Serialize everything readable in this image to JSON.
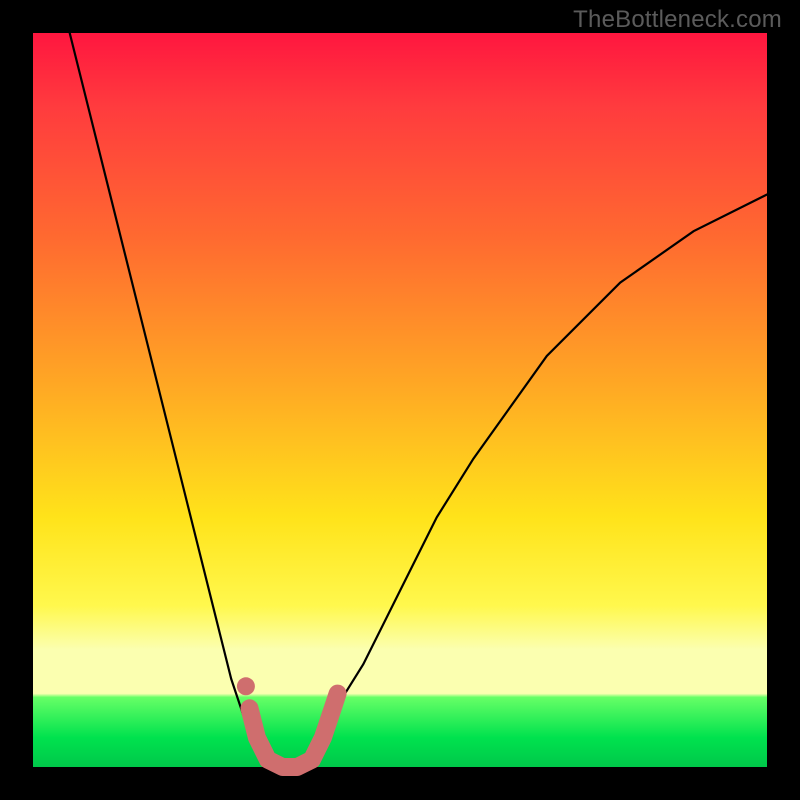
{
  "watermark": "TheBottleneck.com",
  "chart_data": {
    "type": "line",
    "title": "",
    "xlabel": "",
    "ylabel": "",
    "xlim": [
      0,
      100
    ],
    "ylim": [
      0,
      100
    ],
    "series": [
      {
        "name": "bottleneck-curve",
        "x": [
          5,
          10,
          15,
          20,
          25,
          27,
          29,
          31,
          33,
          34,
          35,
          36,
          38,
          40,
          45,
          50,
          55,
          60,
          70,
          80,
          90,
          100
        ],
        "y": [
          100,
          80,
          60,
          40,
          20,
          12,
          6,
          2,
          0,
          0,
          0,
          0,
          2,
          6,
          14,
          24,
          34,
          42,
          56,
          66,
          73,
          78
        ]
      }
    ],
    "highlight": {
      "name": "bottom-u-marker",
      "color": "#d06a6a",
      "points": [
        {
          "x": 29.5,
          "y": 8
        },
        {
          "x": 30.5,
          "y": 4
        },
        {
          "x": 32,
          "y": 1
        },
        {
          "x": 34,
          "y": 0
        },
        {
          "x": 36,
          "y": 0
        },
        {
          "x": 38,
          "y": 1
        },
        {
          "x": 39.5,
          "y": 4
        },
        {
          "x": 40.5,
          "y": 7
        },
        {
          "x": 41.5,
          "y": 10
        }
      ],
      "dot": {
        "x": 29,
        "y": 11
      }
    }
  }
}
